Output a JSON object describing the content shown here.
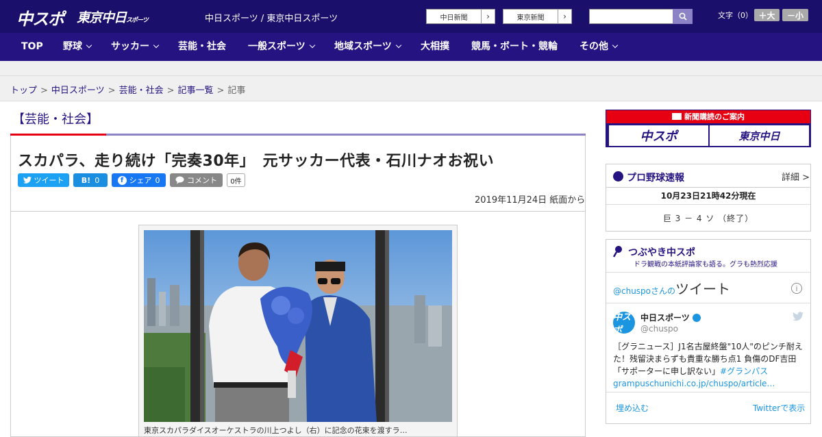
{
  "header": {
    "logo_chuspo": "中スポ",
    "logo_tokyo": "東京中日",
    "logo_tokyo_small": "スポーツ",
    "site_names": "中日スポーツ / 東京中日スポーツ",
    "btn_chunichi": "中日新聞",
    "btn_tokyo": "東京新聞",
    "search_placeholder": "",
    "font_label": "文字（0）",
    "font_large": "＋大",
    "font_small": "－小"
  },
  "nav": {
    "items": [
      {
        "label": "TOP",
        "dropdown": false
      },
      {
        "label": "野球",
        "dropdown": true
      },
      {
        "label": "サッカー",
        "dropdown": true
      },
      {
        "label": "芸能・社会",
        "dropdown": false
      },
      {
        "label": "一般スポーツ",
        "dropdown": true
      },
      {
        "label": "地域スポーツ",
        "dropdown": true
      },
      {
        "label": "大相撲",
        "dropdown": false
      },
      {
        "label": "競馬・ボート・競輪",
        "dropdown": false
      },
      {
        "label": "その他",
        "dropdown": true
      }
    ]
  },
  "breadcrumb": {
    "items": [
      "トップ",
      "中日スポーツ",
      "芸能・社会",
      "記事一覧"
    ],
    "current": "記事",
    "separator": ">"
  },
  "article": {
    "section": "【芸能・社会】",
    "headline": "スカパラ、走り続け「完奏30年」　元サッカー代表・石川ナオお祝い",
    "share_tweet": "ツイート",
    "share_hatena_label": "B!",
    "share_hatena_count": "0",
    "share_fb_label": "シェア",
    "share_fb_count": "0",
    "share_comment": "コメント",
    "comment_count": "0件",
    "dateline": "2019年11月24日 紙面から",
    "caption": "東京スカパラダイスオーケストラの川上つよし（右）に記念の花束を渡すラ…"
  },
  "sidebar": {
    "promo_title": "新聞購読のご案内",
    "promo_chuspo": "中スポ",
    "promo_tokyo": "東京中日",
    "baseball": {
      "title": "プロ野球速報",
      "more": "詳細 >",
      "time": "10月23日21時42分現在",
      "score": "巨 3 － 4 ソ （終了）"
    },
    "tweets": {
      "title": "つぶやき中スポ",
      "subtitle": "ドラ観戦の本紙評論家も語る。グラも熱烈応援",
      "header_handle": "@chuspoさんの",
      "header_word": "ツイート",
      "name": "中日スポーツ",
      "handle": "@chuspo",
      "text": "［グラニュース］J1名古屋終盤\"10人\"のピンチ耐えた！残留決まらずも貴重な勝ち点1 負傷のDF吉田「サポーターに申し訳ない」",
      "hashtag": "#グランパス",
      "link": "grampuschunichi.co.jp/chuspo/article…",
      "embed": "埋め込む",
      "view": "Twitterで表示",
      "avatar_text": "中スポ"
    }
  },
  "colors": {
    "brand": "#1a0f6b",
    "nav": "#241380",
    "accent_red": "#e60012",
    "twitter": "#1da1f2"
  },
  "icons": {
    "search": "search-icon",
    "chevron": "chevron-down-icon",
    "tweet": "twitter-icon",
    "facebook": "facebook-icon",
    "comment": "comment-icon",
    "baseball": "baseball-icon",
    "microphone": "microphone-icon",
    "info": "info-icon",
    "verified": "verified-icon"
  }
}
